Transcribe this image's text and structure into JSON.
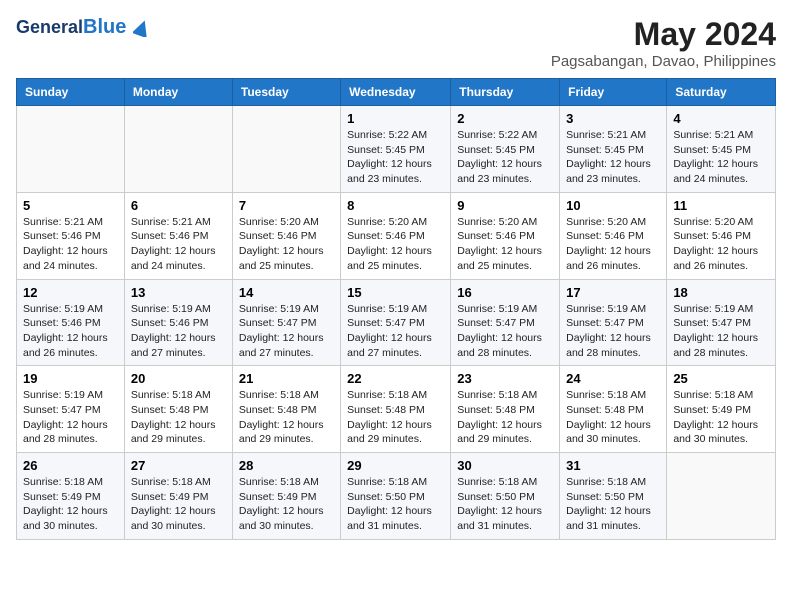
{
  "header": {
    "logo_general": "General",
    "logo_blue": "Blue",
    "title": "May 2024",
    "subtitle": "Pagsabangan, Davao, Philippines"
  },
  "weekdays": [
    "Sunday",
    "Monday",
    "Tuesday",
    "Wednesday",
    "Thursday",
    "Friday",
    "Saturday"
  ],
  "weeks": [
    [
      {
        "day": "",
        "info": ""
      },
      {
        "day": "",
        "info": ""
      },
      {
        "day": "",
        "info": ""
      },
      {
        "day": "1",
        "info": "Sunrise: 5:22 AM\nSunset: 5:45 PM\nDaylight: 12 hours\nand 23 minutes."
      },
      {
        "day": "2",
        "info": "Sunrise: 5:22 AM\nSunset: 5:45 PM\nDaylight: 12 hours\nand 23 minutes."
      },
      {
        "day": "3",
        "info": "Sunrise: 5:21 AM\nSunset: 5:45 PM\nDaylight: 12 hours\nand 23 minutes."
      },
      {
        "day": "4",
        "info": "Sunrise: 5:21 AM\nSunset: 5:45 PM\nDaylight: 12 hours\nand 24 minutes."
      }
    ],
    [
      {
        "day": "5",
        "info": "Sunrise: 5:21 AM\nSunset: 5:46 PM\nDaylight: 12 hours\nand 24 minutes."
      },
      {
        "day": "6",
        "info": "Sunrise: 5:21 AM\nSunset: 5:46 PM\nDaylight: 12 hours\nand 24 minutes."
      },
      {
        "day": "7",
        "info": "Sunrise: 5:20 AM\nSunset: 5:46 PM\nDaylight: 12 hours\nand 25 minutes."
      },
      {
        "day": "8",
        "info": "Sunrise: 5:20 AM\nSunset: 5:46 PM\nDaylight: 12 hours\nand 25 minutes."
      },
      {
        "day": "9",
        "info": "Sunrise: 5:20 AM\nSunset: 5:46 PM\nDaylight: 12 hours\nand 25 minutes."
      },
      {
        "day": "10",
        "info": "Sunrise: 5:20 AM\nSunset: 5:46 PM\nDaylight: 12 hours\nand 26 minutes."
      },
      {
        "day": "11",
        "info": "Sunrise: 5:20 AM\nSunset: 5:46 PM\nDaylight: 12 hours\nand 26 minutes."
      }
    ],
    [
      {
        "day": "12",
        "info": "Sunrise: 5:19 AM\nSunset: 5:46 PM\nDaylight: 12 hours\nand 26 minutes."
      },
      {
        "day": "13",
        "info": "Sunrise: 5:19 AM\nSunset: 5:46 PM\nDaylight: 12 hours\nand 27 minutes."
      },
      {
        "day": "14",
        "info": "Sunrise: 5:19 AM\nSunset: 5:47 PM\nDaylight: 12 hours\nand 27 minutes."
      },
      {
        "day": "15",
        "info": "Sunrise: 5:19 AM\nSunset: 5:47 PM\nDaylight: 12 hours\nand 27 minutes."
      },
      {
        "day": "16",
        "info": "Sunrise: 5:19 AM\nSunset: 5:47 PM\nDaylight: 12 hours\nand 28 minutes."
      },
      {
        "day": "17",
        "info": "Sunrise: 5:19 AM\nSunset: 5:47 PM\nDaylight: 12 hours\nand 28 minutes."
      },
      {
        "day": "18",
        "info": "Sunrise: 5:19 AM\nSunset: 5:47 PM\nDaylight: 12 hours\nand 28 minutes."
      }
    ],
    [
      {
        "day": "19",
        "info": "Sunrise: 5:19 AM\nSunset: 5:47 PM\nDaylight: 12 hours\nand 28 minutes."
      },
      {
        "day": "20",
        "info": "Sunrise: 5:18 AM\nSunset: 5:48 PM\nDaylight: 12 hours\nand 29 minutes."
      },
      {
        "day": "21",
        "info": "Sunrise: 5:18 AM\nSunset: 5:48 PM\nDaylight: 12 hours\nand 29 minutes."
      },
      {
        "day": "22",
        "info": "Sunrise: 5:18 AM\nSunset: 5:48 PM\nDaylight: 12 hours\nand 29 minutes."
      },
      {
        "day": "23",
        "info": "Sunrise: 5:18 AM\nSunset: 5:48 PM\nDaylight: 12 hours\nand 29 minutes."
      },
      {
        "day": "24",
        "info": "Sunrise: 5:18 AM\nSunset: 5:48 PM\nDaylight: 12 hours\nand 30 minutes."
      },
      {
        "day": "25",
        "info": "Sunrise: 5:18 AM\nSunset: 5:49 PM\nDaylight: 12 hours\nand 30 minutes."
      }
    ],
    [
      {
        "day": "26",
        "info": "Sunrise: 5:18 AM\nSunset: 5:49 PM\nDaylight: 12 hours\nand 30 minutes."
      },
      {
        "day": "27",
        "info": "Sunrise: 5:18 AM\nSunset: 5:49 PM\nDaylight: 12 hours\nand 30 minutes."
      },
      {
        "day": "28",
        "info": "Sunrise: 5:18 AM\nSunset: 5:49 PM\nDaylight: 12 hours\nand 30 minutes."
      },
      {
        "day": "29",
        "info": "Sunrise: 5:18 AM\nSunset: 5:50 PM\nDaylight: 12 hours\nand 31 minutes."
      },
      {
        "day": "30",
        "info": "Sunrise: 5:18 AM\nSunset: 5:50 PM\nDaylight: 12 hours\nand 31 minutes."
      },
      {
        "day": "31",
        "info": "Sunrise: 5:18 AM\nSunset: 5:50 PM\nDaylight: 12 hours\nand 31 minutes."
      },
      {
        "day": "",
        "info": ""
      }
    ]
  ]
}
